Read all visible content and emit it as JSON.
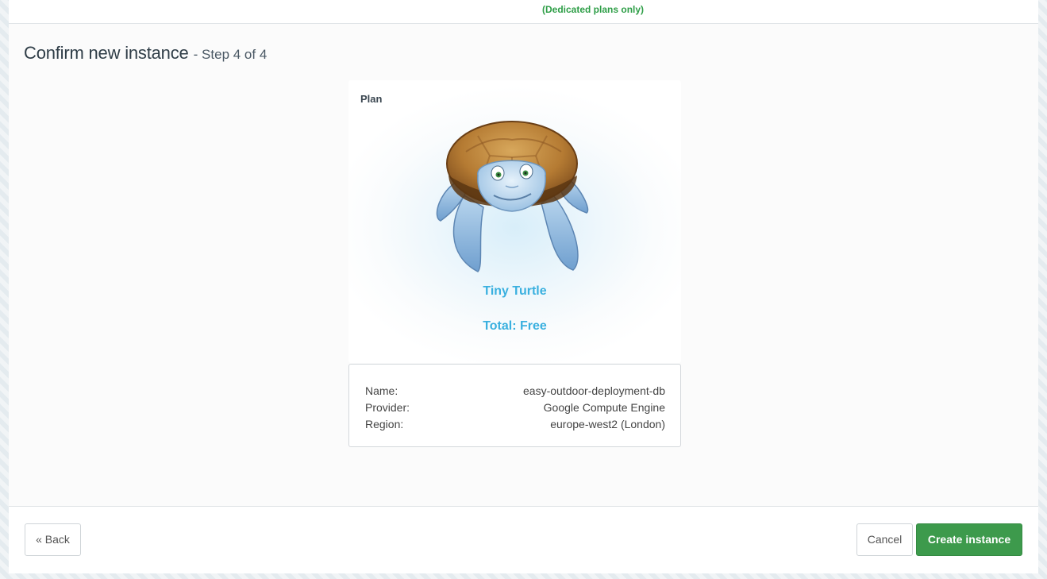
{
  "top": {
    "dedicated_note": "(Dedicated plans only)"
  },
  "header": {
    "title": "Confirm new instance",
    "step": "- Step 4 of 4"
  },
  "plan": {
    "label": "Plan",
    "image_icon": "turtle-mascot-icon",
    "name": "Tiny Turtle",
    "total": "Total: Free"
  },
  "details": {
    "rows": [
      {
        "label": "Name:",
        "value": "easy-outdoor-deployment-db"
      },
      {
        "label": "Provider:",
        "value": "Google Compute Engine"
      },
      {
        "label": "Region:",
        "value": "europe-west2 (London)"
      }
    ]
  },
  "footer": {
    "back_label": "« Back",
    "cancel_label": "Cancel",
    "create_label": "Create instance"
  },
  "colors": {
    "accent": "#3ab0df",
    "primary_button": "#3d9a4c",
    "notice_green": "#2e9e47"
  }
}
